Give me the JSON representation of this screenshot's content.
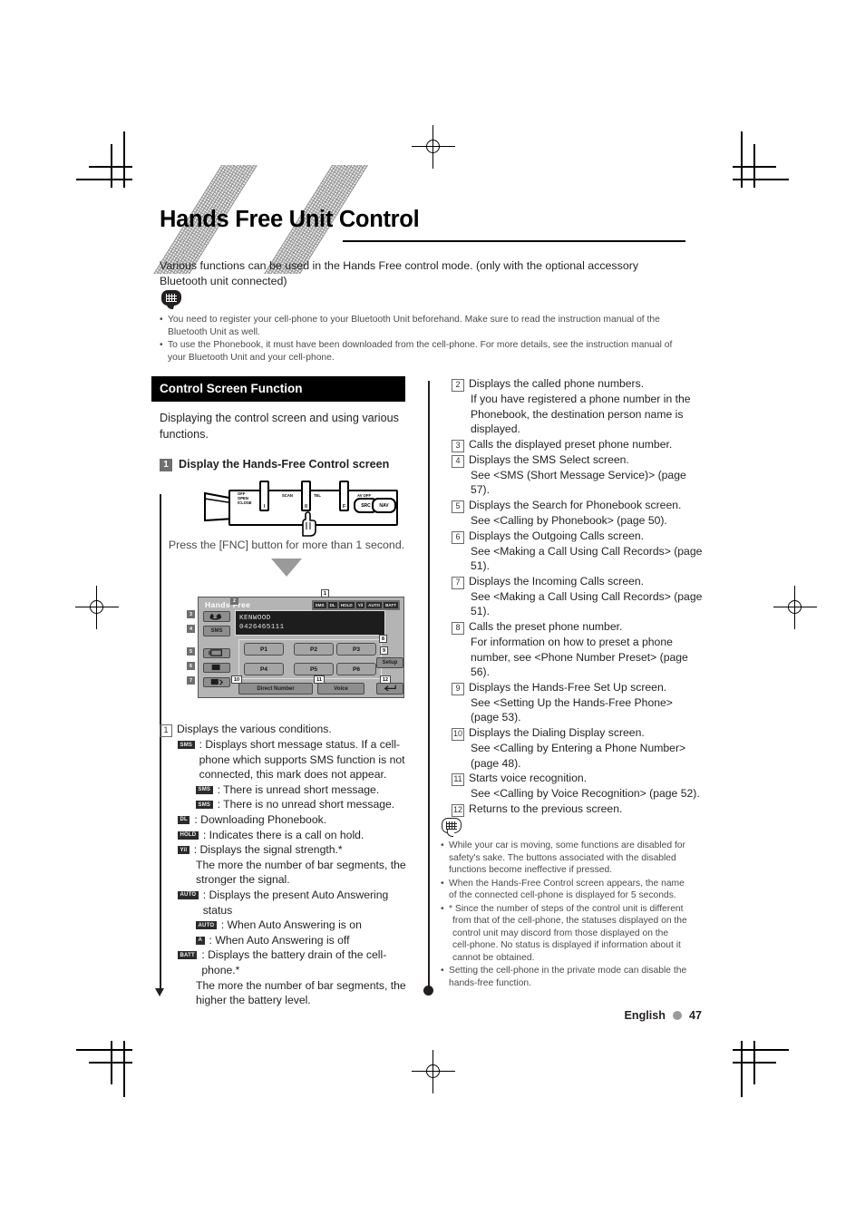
{
  "page": {
    "title": "Hands Free Unit Control",
    "intro": "Various functions can be used in the Hands Free control mode. (only with the optional accessory Bluetooth unit connected)",
    "footer_language": "English",
    "footer_page": "47"
  },
  "top_notes": {
    "icon": "note-bubble-icon",
    "bullet": "•",
    "items": [
      "You need to register your cell-phone to your Bluetooth Unit beforehand. Make sure to read the instruction manual of the Bluetooth Unit as well.",
      "To use the Phonebook, it must have been downloaded from the cell-phone. For more details, see the instruction manual of your Bluetooth Unit and your cell-phone."
    ]
  },
  "section": {
    "header": "Control Screen Function",
    "description": "Displaying the control screen and using various functions.",
    "step_number": "1",
    "step_label": "Display the Hands-Free Control screen",
    "press_instruction": "Press the [FNC] button for more than 1 second."
  },
  "faceplate": {
    "captions": [
      "OFF",
      "OPEN",
      "/CLOSE",
      "SCAN",
      "TEL",
      "AV OFF"
    ],
    "cap_off": "OFF",
    "cap_open": "OPEN",
    "cap_close": "/CLOSE",
    "cap_scan": "SCAN",
    "cap_tel": "TEL",
    "cap_avoff": "AV OFF",
    "buttons": [
      "I",
      "II",
      "F",
      "SRC",
      "NAV"
    ],
    "btn1": "I",
    "btn2": "II",
    "btn3": "F",
    "btn_src": "SRC",
    "btn_nav": "NAV",
    "hand_icon": "pointing-hand-icon"
  },
  "lcd": {
    "title": "Hands Free",
    "status_icons": [
      "SMS",
      "DL",
      "HOLD",
      "Yil",
      "AUTO",
      "BATT"
    ],
    "st_sms": "SMS",
    "st_dl": "DL",
    "st_hold": "HOLD",
    "st_signal": "Yil",
    "st_auto": "AUTO",
    "st_batt": "BATT",
    "info_line1": "KENWOOD",
    "info_line2": "0426465111",
    "presets": [
      "P1",
      "P2",
      "P3",
      "P4",
      "P5",
      "P6"
    ],
    "setup_label": "Setup",
    "direct_number_label": "Direct Number",
    "voice_label": "Voice",
    "side_buttons": [
      "call-icon",
      "sms-icon",
      "phonebook-icon",
      "outgoing-icon",
      "incoming-icon"
    ],
    "sms_button_label": "SMS",
    "return_icon": "return-arrow-icon",
    "callouts": [
      "1",
      "2",
      "3",
      "4",
      "5",
      "6",
      "7",
      "8",
      "9",
      "10",
      "11",
      "12"
    ]
  },
  "left_list": {
    "item1_num": "1",
    "item1_text": "Displays the various conditions.",
    "sms_badge": "SMS",
    "sms_text": ": Displays short message status. If a cell-phone which supports SMS function is not connected, this mark does not appear.",
    "sms_unread_badge": "SMS",
    "sms_unread_text": ": There is unread short message.",
    "sms_read_badge": "SMS",
    "sms_read_text": ": There is no unread short message.",
    "dl_badge": "DL",
    "dl_text": ": Downloading Phonebook.",
    "hold_badge": "HOLD",
    "hold_text": ": Indicates there is a call on hold.",
    "signal_badge": "Yil",
    "signal_text": ": Displays the signal strength.*",
    "signal_note": "The more the number of bar segments, the stronger the signal.",
    "auto_badge": "AUTO",
    "auto_text": ": Displays the present Auto Answering status",
    "auto_on_badge": "AUTO",
    "auto_on_text": ": When Auto Answering is on",
    "auto_off_badge": "A",
    "auto_off_text": ": When Auto Answering is off",
    "batt_badge": "BATT",
    "batt_text": ": Displays the battery drain of the cell-phone.*",
    "batt_note": "The more the number of bar segments, the higher the battery level."
  },
  "right_list": [
    {
      "num": "2",
      "text": "Displays the called phone numbers.",
      "sub": "If you have registered a phone number in the Phonebook, the destination person name is displayed."
    },
    {
      "num": "3",
      "text": "Calls the displayed preset phone number.",
      "sub": ""
    },
    {
      "num": "4",
      "text": "Displays the SMS Select screen.",
      "sub": "See <SMS (Short Message Service)> (page 57)."
    },
    {
      "num": "5",
      "text": "Displays the Search for Phonebook screen.",
      "sub": "See <Calling by Phonebook> (page 50)."
    },
    {
      "num": "6",
      "text": "Displays the Outgoing Calls screen.",
      "sub": "See <Making a Call Using Call Records> (page 51)."
    },
    {
      "num": "7",
      "text": "Displays the Incoming Calls screen.",
      "sub": "See <Making a Call Using Call Records> (page 51)."
    },
    {
      "num": "8",
      "text": "Calls the preset phone number.",
      "sub": "For information on how to preset a phone number, see <Phone Number Preset> (page 56)."
    },
    {
      "num": "9",
      "text": "Displays the Hands-Free Set Up screen.",
      "sub": "See <Setting Up the Hands-Free Phone> (page 53)."
    },
    {
      "num": "10",
      "text": "Displays the Dialing Display screen.",
      "sub": "See <Calling by Entering a Phone Number> (page 48)."
    },
    {
      "num": "11",
      "text": "Starts voice recognition.",
      "sub": "See <Calling by Voice Recognition> (page 52)."
    },
    {
      "num": "12",
      "text": "Returns to the previous screen.",
      "sub": ""
    }
  ],
  "bottom_notes": {
    "icon": "note-bubble-outline-icon",
    "bullet": "•",
    "items": [
      "While your car is moving, some functions are disabled for safety's sake. The buttons associated with the disabled functions become ineffective if pressed.",
      "When the Hands-Free Control screen appears, the name of the connected cell-phone is displayed for 5 seconds.",
      "* Since the number of steps of the control unit is different from that of the cell-phone, the statuses displayed on the control unit may discord from those displayed on the cell-phone. No status is displayed if information about it cannot be obtained.",
      "Setting the cell-phone in the private mode can disable the hands-free function."
    ]
  }
}
